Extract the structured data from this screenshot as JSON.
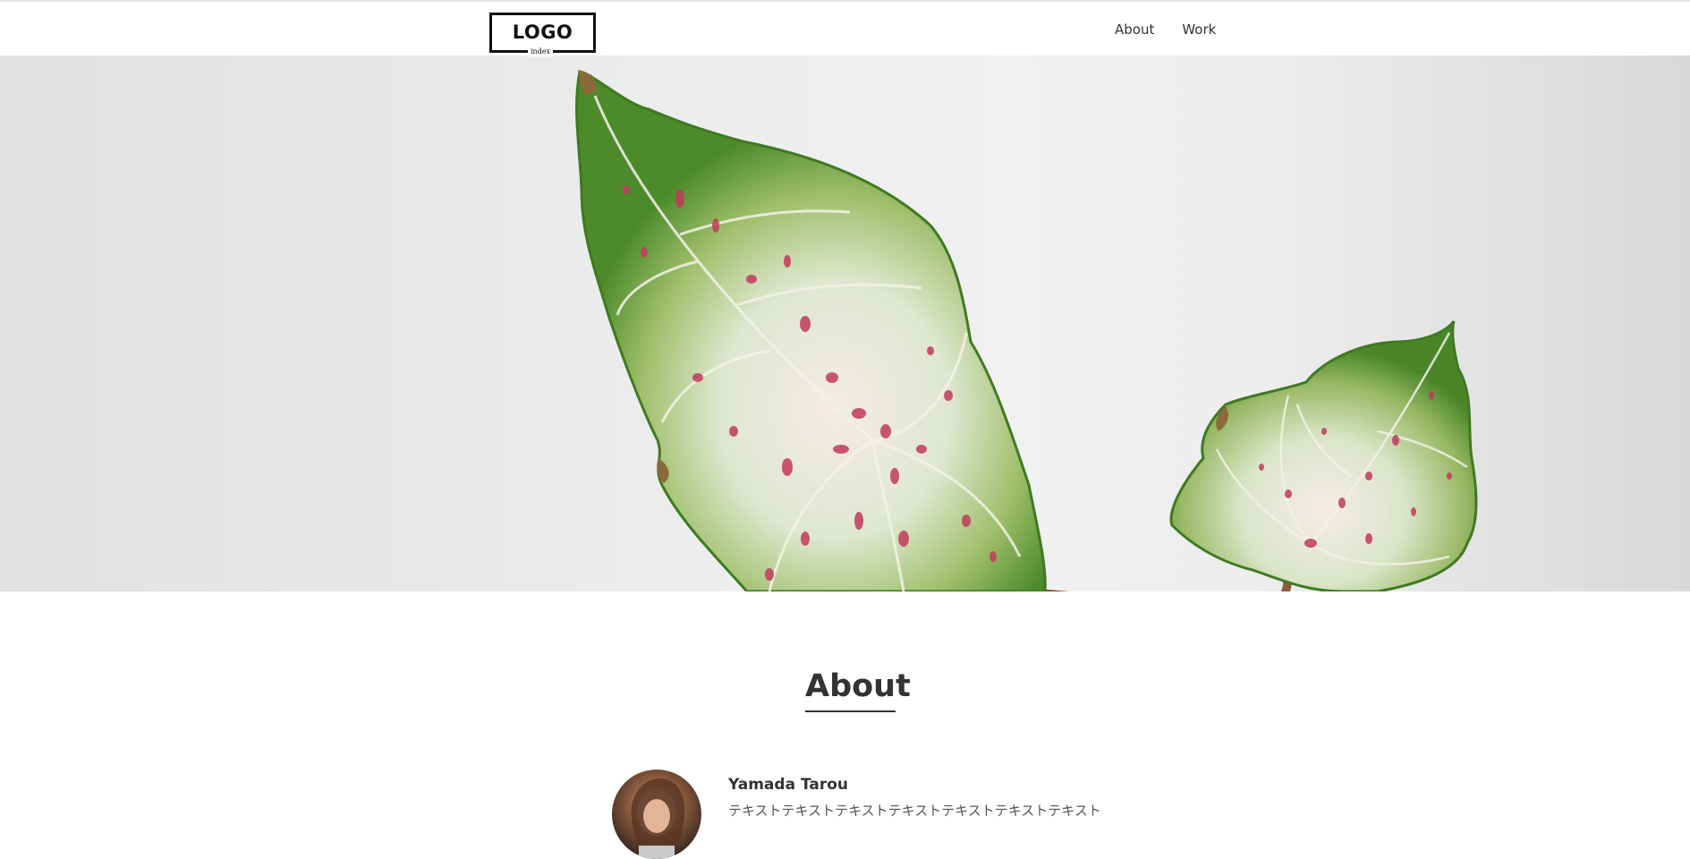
{
  "header": {
    "logo": {
      "text": "LOGO",
      "sub": "index"
    },
    "nav": [
      {
        "label": "About"
      },
      {
        "label": "Work"
      }
    ]
  },
  "hero": {
    "image": "caladium-leaves-photo"
  },
  "about": {
    "title": "About",
    "profile": {
      "name": "Yamada Tarou",
      "text": "テキストテキストテキストテキストテキストテキストテキスト"
    }
  },
  "colors": {
    "text": "#333333",
    "leaf_green": "#4f8a2e",
    "leaf_pink": "#c23a5c",
    "background": "#ffffff"
  }
}
